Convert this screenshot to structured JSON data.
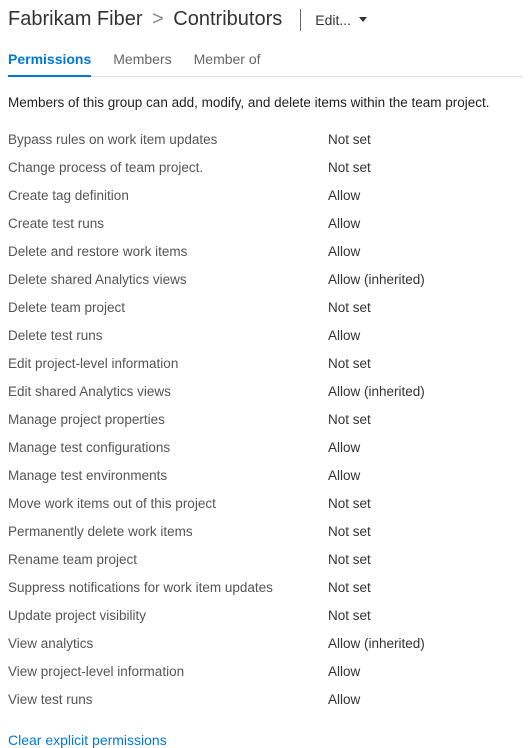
{
  "header": {
    "breadcrumb_project": "Fabrikam Fiber",
    "breadcrumb_sep": ">",
    "breadcrumb_group": "Contributors",
    "edit_label": "Edit..."
  },
  "tabs": [
    {
      "label": "Permissions",
      "active": true
    },
    {
      "label": "Members",
      "active": false
    },
    {
      "label": "Member of",
      "active": false
    }
  ],
  "description": "Members of this group can add, modify, and delete items within the team project.",
  "permissions": [
    {
      "label": "Bypass rules on work item updates",
      "value": "Not set"
    },
    {
      "label": "Change process of team project.",
      "value": "Not set"
    },
    {
      "label": "Create tag definition",
      "value": "Allow"
    },
    {
      "label": "Create test runs",
      "value": "Allow"
    },
    {
      "label": "Delete and restore work items",
      "value": "Allow"
    },
    {
      "label": "Delete shared Analytics views",
      "value": "Allow (inherited)"
    },
    {
      "label": "Delete team project",
      "value": "Not set"
    },
    {
      "label": "Delete test runs",
      "value": "Allow"
    },
    {
      "label": "Edit project-level information",
      "value": "Not set"
    },
    {
      "label": "Edit shared Analytics views",
      "value": "Allow (inherited)"
    },
    {
      "label": "Manage project properties",
      "value": "Not set"
    },
    {
      "label": "Manage test configurations",
      "value": "Allow"
    },
    {
      "label": "Manage test environments",
      "value": "Allow"
    },
    {
      "label": "Move work items out of this project",
      "value": "Not set"
    },
    {
      "label": "Permanently delete work items",
      "value": "Not set"
    },
    {
      "label": "Rename team project",
      "value": "Not set"
    },
    {
      "label": "Suppress notifications for work item updates",
      "value": "Not set"
    },
    {
      "label": "Update project visibility",
      "value": "Not set"
    },
    {
      "label": "View analytics",
      "value": "Allow (inherited)"
    },
    {
      "label": "View project-level information",
      "value": "Allow"
    },
    {
      "label": "View test runs",
      "value": "Allow"
    }
  ],
  "actions": {
    "clear_explicit": "Clear explicit permissions"
  }
}
